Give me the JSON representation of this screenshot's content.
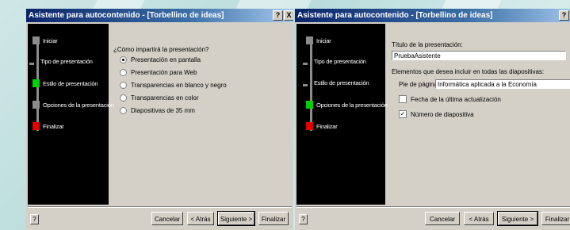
{
  "wizard1": {
    "title": "Asistente para autocontenido - [Torbellino de ideas]",
    "steps": [
      {
        "label": "Iniciar",
        "color": "#8c8c8c"
      },
      {
        "label": "Tipo de presentación",
        "color": "#8c8c8c"
      },
      {
        "label": "Estilo de presentación",
        "color": "#00d000"
      },
      {
        "label": "Opciones de la presentación",
        "color": "#8c8c8c"
      },
      {
        "label": "Finalizar",
        "color": "#e00000"
      }
    ],
    "question": "¿Cómo impartirá la presentación?",
    "options": [
      {
        "label": "Presentación en pantalla",
        "selected": true
      },
      {
        "label": "Presentación para Web",
        "selected": false
      },
      {
        "label": "Transparencias en blanco y negro",
        "selected": false
      },
      {
        "label": "Transparencias en color",
        "selected": false
      },
      {
        "label": "Diapositivas de 35 mm",
        "selected": false
      }
    ],
    "buttons": {
      "cancel": "Cancelar",
      "back": "< Atrás",
      "next": "Siguiente >",
      "finish": "Finalizar"
    }
  },
  "wizard2": {
    "title": "Asistente para autocontenido - [Torbellino de ideas]",
    "steps": [
      {
        "label": "Iniciar",
        "color": "#8c8c8c"
      },
      {
        "label": "Tipo de presentación",
        "color": "#8c8c8c"
      },
      {
        "label": "Estilo de presentación",
        "color": "#8c8c8c"
      },
      {
        "label": "Opciones de la presentación",
        "color": "#00d000"
      },
      {
        "label": "Finalizar",
        "color": "#e00000"
      }
    ],
    "title_label": "Título de la presentación:",
    "title_value": "PruebaAsistente",
    "elements_label": "Elementos que desea incluir en todas las diapositivas:",
    "footer_label": "Pie de página:",
    "footer_value": "Informática aplicada a la Economía",
    "date_check": {
      "label": "Fecha de la última actualización",
      "checked": false
    },
    "number_check": {
      "label": "Número de diapositiva",
      "checked": true
    },
    "buttons": {
      "cancel": "Cancelar",
      "back": "< Atrás",
      "next": "Siguiente >",
      "finish": "Finalizar"
    }
  },
  "titlebar_buttons": {
    "help": "?",
    "close": "X"
  },
  "help_glyph": "?"
}
